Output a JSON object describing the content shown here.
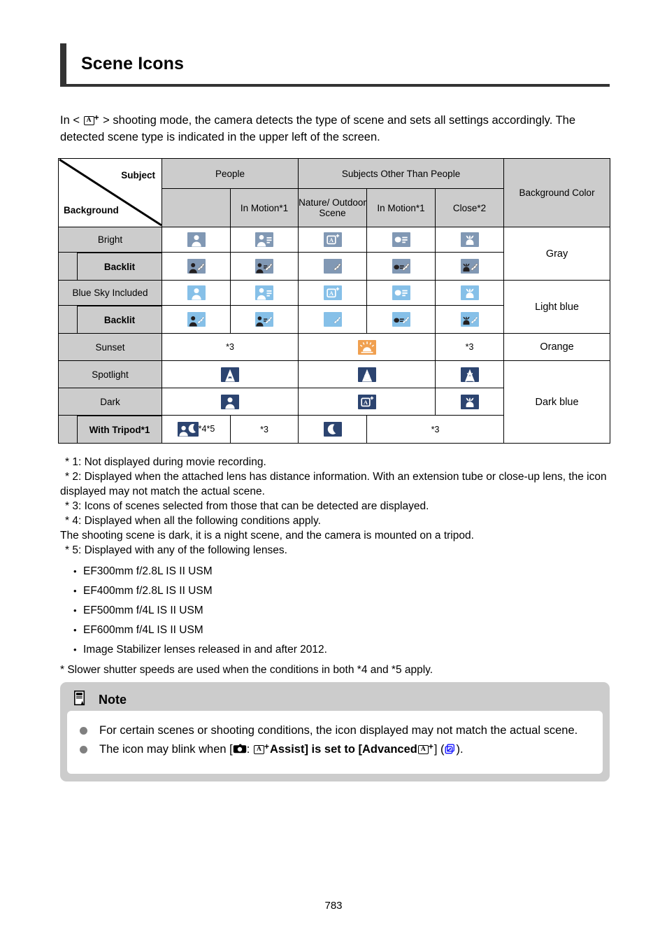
{
  "page": {
    "title": "Scene Icons",
    "page_number": "783"
  },
  "intro": {
    "before_icon": "In <",
    "icon": "a-plus-mode-icon",
    "after_icon": "> shooting mode, the camera detects the type of scene and sets all settings accordingly. The detected scene type is indicated in the upper left of the screen."
  },
  "table": {
    "corner": {
      "subject_label": "Subject",
      "background_label": "Background"
    },
    "group_headers": {
      "people": "People",
      "other": "Subjects Other Than People",
      "bg_color": "Background Color"
    },
    "sub_headers": {
      "people_still": "",
      "people_in_motion": "In Motion*1",
      "nature": "Nature/ Outdoor Scene",
      "other_in_motion": "In Motion*1",
      "close": "Close*2"
    },
    "rows": [
      {
        "label": "Bright",
        "sub": false,
        "tone": "gray",
        "cells": [
          "person-icon",
          "person-in-motion-icon",
          "nature-outdoor-icon",
          "object-in-motion-icon",
          "close-up-icon"
        ],
        "bg_color": "Gray"
      },
      {
        "label": "Backlit",
        "sub": true,
        "tone": "gray",
        "cells": [
          "person-backlit-icon",
          "person-in-motion-backlit-icon",
          "nature-backlit-icon",
          "object-in-motion-backlit-icon",
          "close-up-backlit-icon"
        ]
      },
      {
        "label": "Blue Sky Included",
        "sub": false,
        "tone": "lblue",
        "cells": [
          "person-icon",
          "person-in-motion-icon",
          "nature-outdoor-icon",
          "object-in-motion-icon",
          "close-up-icon"
        ],
        "bg_color": "Light blue"
      },
      {
        "label": "Backlit",
        "sub": true,
        "tone": "lblue",
        "cells": [
          "person-backlit-icon",
          "person-in-motion-backlit-icon",
          "nature-backlit-icon",
          "object-in-motion-backlit-icon",
          "close-up-backlit-icon"
        ]
      },
      {
        "label": "Sunset",
        "sub": false,
        "tone": "orange",
        "bg_color": "Orange",
        "people_note": "*3",
        "sunset_icon": "sunset-icon",
        "close_note": "*3"
      },
      {
        "label": "Spotlight",
        "sub": false,
        "tone": "dblue",
        "cells": [
          "spotlight-person-icon",
          "spotlight-object-icon",
          "spotlight-close-up-icon"
        ],
        "bg_color": "Dark blue"
      },
      {
        "label": "Dark",
        "sub": false,
        "tone": "dblue",
        "cells": [
          "dark-person-icon",
          "dark-nature-icon",
          "dark-close-up-icon"
        ]
      },
      {
        "label": "With Tripod*1",
        "sub": true,
        "tone": "dblue",
        "tripod_icon": "night-portrait-tripod-icon",
        "tripod_note": "*4*5",
        "motion_note": "*3",
        "night_icon": "night-scene-tripod-icon",
        "right_note": "*3"
      }
    ]
  },
  "footnotes": {
    "f1": "* 1: Not displayed during movie recording.",
    "f2": "* 2: Displayed when the attached lens has distance information. With an extension tube or close-up lens, the icon displayed may not match the actual scene.",
    "f3": "* 3: Icons of scenes selected from those that can be detected are displayed.",
    "f4": "* 4: Displayed when all the following conditions apply.",
    "f4_cont": "The shooting scene is dark, it is a night scene, and the camera is mounted on a tripod.",
    "f5": "* 5: Displayed with any of the following lenses.",
    "lenses": [
      "EF300mm f/2.8L IS II USM",
      "EF400mm f/2.8L IS II USM",
      "EF500mm f/4L IS II USM",
      "EF600mm f/4L IS II USM",
      "Image Stabilizer lenses released in and after 2012."
    ],
    "f_last": "* Slower shutter speeds are used when the conditions in both *4 and *5 apply."
  },
  "note": {
    "heading": "Note",
    "heading_icon": "note-document-icon",
    "items": [
      {
        "text": "For certain scenes or shooting conditions, the icon displayed may not match the actual scene."
      },
      {
        "part1": "The icon may blink when [",
        "camera_icon": "camera-icon",
        "part2": ":",
        "aplus_icon": "a-plus-mode-icon",
        "part3": "Assist] is set to [Advanced",
        "aplus_icon2": "a-plus-mode-icon",
        "part4": "] (",
        "link_icon": "link-reference-icon",
        "part5": ")."
      }
    ]
  },
  "colors": {
    "gray_icon": "#8198b4",
    "light_blue_icon": "#86c0e8",
    "dark_blue_icon": "#2c4470",
    "orange_icon": "#f0a050",
    "header_bg": "#cccccc",
    "title_bar": "#333333",
    "link_blue": "#1414ff"
  }
}
